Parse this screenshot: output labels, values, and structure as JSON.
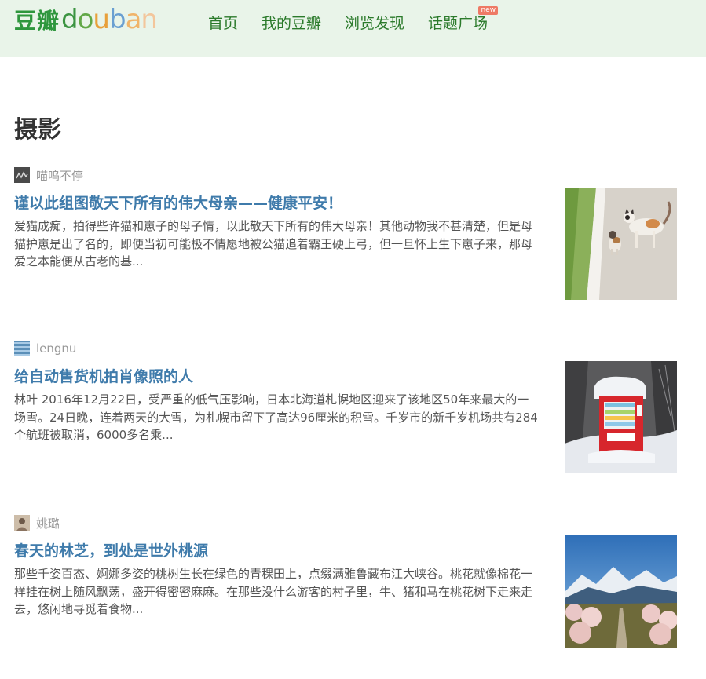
{
  "header": {
    "logo_cn": "豆瓣",
    "logo_en_letters": [
      {
        "ch": "d",
        "color": "#3b9441"
      },
      {
        "ch": "o",
        "color": "#62a847"
      },
      {
        "ch": "u",
        "color": "#e8a03a"
      },
      {
        "ch": "b",
        "color": "#6a9fd1"
      },
      {
        "ch": "a",
        "color": "#f0b46a"
      },
      {
        "ch": "n",
        "color": "#f3c69c"
      }
    ],
    "nav": [
      {
        "label": "首页",
        "badge": ""
      },
      {
        "label": "我的豆瓣",
        "badge": ""
      },
      {
        "label": "浏览发现",
        "badge": ""
      },
      {
        "label": "话题广场",
        "badge": "new"
      }
    ]
  },
  "page_title": "摄影",
  "articles": [
    {
      "author": "喵呜不停",
      "avatar_icon": "dark-sketch-avatar",
      "title": "谨以此组图敬天下所有的伟大母亲——健康平安！",
      "excerpt": "爱猫成痴，拍得些许猫和崽子的母子情，以此敬天下所有的伟大母亲！其他动物我不甚清楚，但是母猫护崽是出了名的，即便当初可能极不情愿地被公猫追着霸王硬上弓，但一旦怀上生下崽子来，那母爱之本能便从古老的基...",
      "thumb_icon": "cats-on-curb-photo"
    },
    {
      "author": "lengnu",
      "avatar_icon": "blue-stripes-avatar",
      "title": "给自动售货机拍肖像照的人",
      "excerpt": "林叶 2016年12月22日，受严重的低气压影响，日本北海道札幌地区迎来了该地区50年来最大的一场雪。24日晚，连着两天的大雪，为札幌市留下了高达96厘米的积雪。千岁市的新千岁机场共有284个航班被取消，6000多名乘...",
      "thumb_icon": "snow-vending-machine-photo"
    },
    {
      "author": "姚璐",
      "avatar_icon": "beige-portrait-avatar",
      "title": "春天的林芝，到处是世外桃源",
      "excerpt": "那些千姿百态、婀娜多姿的桃树生长在绿色的青稞田上，点缀满雅鲁藏布江大峡谷。桃花就像棉花一样挂在树上随风飘荡，盛开得密密麻麻。在那些没什么游客的村子里，牛、猪和马在桃花树下走来走去，悠闲地寻觅着食物...",
      "thumb_icon": "peach-blossom-mountain-photo"
    }
  ]
}
